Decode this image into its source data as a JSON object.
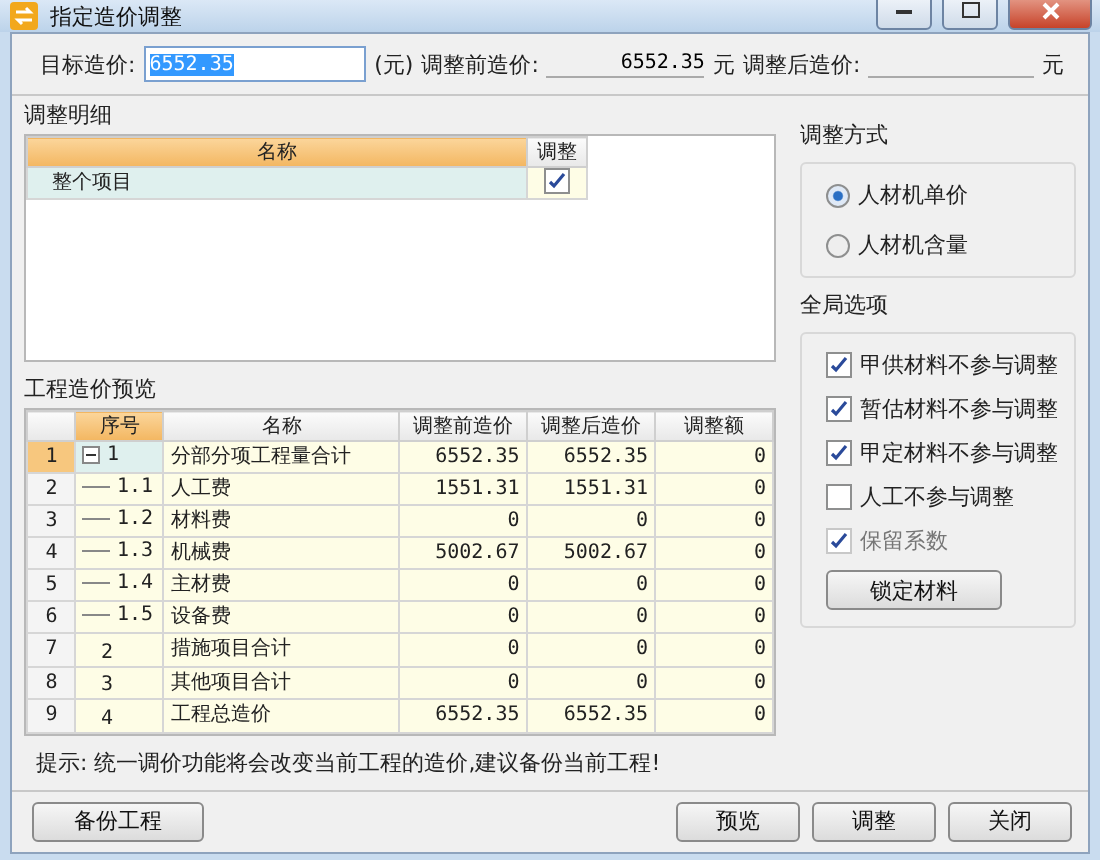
{
  "window": {
    "title": "指定造价调整"
  },
  "top": {
    "target_label": "目标造价:",
    "target_value": "6552.35",
    "unit1": "(元)",
    "before_label": "调整前造价:",
    "before_value": "6552.35",
    "unit2": "元",
    "after_label": "调整后造价:",
    "unit3": "元"
  },
  "detail": {
    "title": "调整明细",
    "columns": [
      "名称",
      "调整"
    ],
    "rows": [
      {
        "name": "整个项目",
        "checked": true
      }
    ]
  },
  "adjust_mode": {
    "title": "调整方式",
    "options": [
      {
        "label": "人材机单价",
        "selected": true
      },
      {
        "label": "人材机含量",
        "selected": false
      }
    ]
  },
  "global_options": {
    "title": "全局选项",
    "items": [
      {
        "label": "甲供材料不参与调整",
        "checked": true,
        "disabled": false
      },
      {
        "label": "暂估材料不参与调整",
        "checked": true,
        "disabled": false
      },
      {
        "label": "甲定材料不参与调整",
        "checked": true,
        "disabled": false
      },
      {
        "label": "人工不参与调整",
        "checked": false,
        "disabled": false
      },
      {
        "label": "保留系数",
        "checked": true,
        "disabled": true
      }
    ],
    "button": "锁定材料"
  },
  "preview": {
    "title": "工程造价预览",
    "columns": [
      "序号",
      "名称",
      "调整前造价",
      "调整后造价",
      "调整额"
    ],
    "rows": [
      {
        "num": "1",
        "seq": "1",
        "name": "分部分项工程量合计",
        "before": "6552.35",
        "after": "6552.35",
        "diff": "0",
        "selected": true,
        "expanded": true,
        "children": [
          {
            "num": "2",
            "seq": "1.1",
            "name": "人工费",
            "before": "1551.31",
            "after": "1551.31",
            "diff": "0",
            "selected": false
          },
          {
            "num": "3",
            "seq": "1.2",
            "name": "材料费",
            "before": "0",
            "after": "0",
            "diff": "0",
            "selected": false
          },
          {
            "num": "4",
            "seq": "1.3",
            "name": "机械费",
            "before": "5002.67",
            "after": "5002.67",
            "diff": "0",
            "selected": false
          },
          {
            "num": "5",
            "seq": "1.4",
            "name": "主材费",
            "before": "0",
            "after": "0",
            "diff": "0",
            "selected": false
          },
          {
            "num": "6",
            "seq": "1.5",
            "name": "设备费",
            "before": "0",
            "after": "0",
            "diff": "0",
            "selected": false
          }
        ]
      },
      {
        "num": "7",
        "seq": "2",
        "name": "措施项目合计",
        "before": "0",
        "after": "0",
        "diff": "0",
        "selected": false
      },
      {
        "num": "8",
        "seq": "3",
        "name": "其他项目合计",
        "before": "0",
        "after": "0",
        "diff": "0",
        "selected": false
      },
      {
        "num": "9",
        "seq": "4",
        "name": "工程总造价",
        "before": "6552.35",
        "after": "6552.35",
        "diff": "0",
        "selected": false
      }
    ]
  },
  "hint": "提示: 统一调价功能将会改变当前工程的造价,建议备份当前工程!",
  "buttons": {
    "left": "备份工程",
    "right": [
      "预览",
      "调整",
      "关闭"
    ]
  }
}
